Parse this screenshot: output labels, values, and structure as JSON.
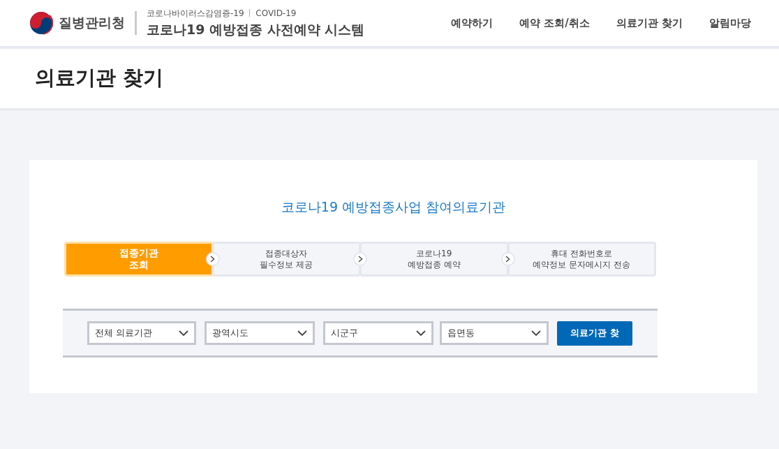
{
  "header": {
    "agency": "질병관리청",
    "subtitle": "코로나바이러스감염증-19",
    "subtitle_en": "COVID-19",
    "system_title": "코로나19 예방접종 사전예약 시스템",
    "nav": [
      {
        "label": "예약하기"
      },
      {
        "label": "예약 조회/취소"
      },
      {
        "label": "의료기관 찾기"
      },
      {
        "label": "알림마당"
      }
    ]
  },
  "page_title": "의료기관 찾기",
  "section_title": "코로나19 예방접종사업 참여의료기관",
  "steps": [
    {
      "lines": [
        "접종기관",
        "조회"
      ],
      "selected": true
    },
    {
      "lines": [
        "접종대상자",
        "필수정보 제공"
      ],
      "selected": false
    },
    {
      "lines": [
        "코로나19",
        "예방접종 예약"
      ],
      "selected": false
    },
    {
      "lines": [
        "휴대 전화번호로",
        "예약정보 문자메시지 전송"
      ],
      "selected": false
    }
  ],
  "filters": [
    {
      "value": "전체 의료기관"
    },
    {
      "value": "광역시도"
    },
    {
      "value": "시군구"
    },
    {
      "value": "읍면동"
    }
  ],
  "search_button": "의료기관 찾"
}
